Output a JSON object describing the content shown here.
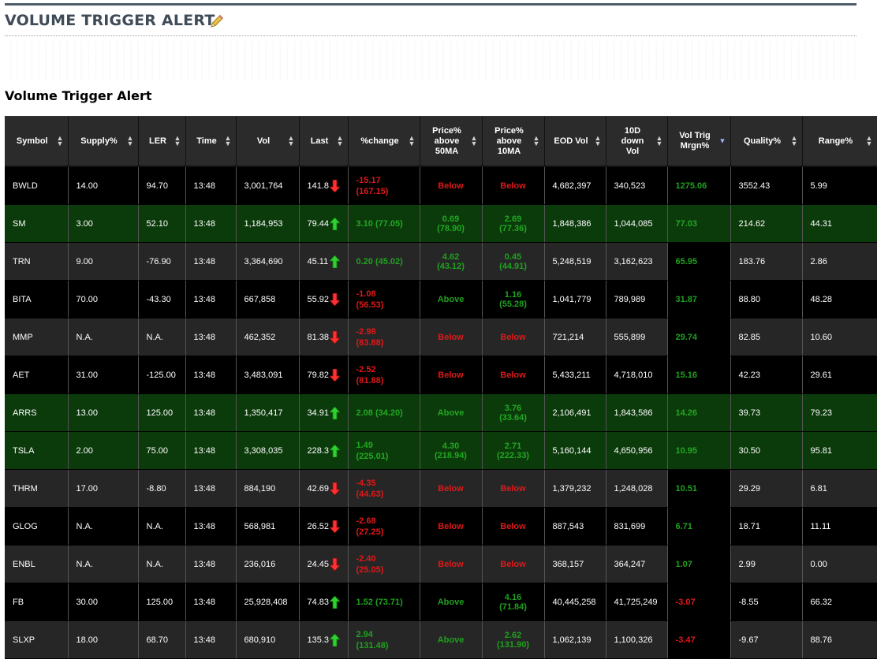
{
  "header": {
    "title": "VOLUME TRIGGER ALERT",
    "edit_icon": "pencil-icon"
  },
  "section": {
    "title": "Volume Trigger Alert"
  },
  "colors": {
    "negative": "#e01818",
    "positive": "#1fa11f",
    "row_green": "#0b3a0b",
    "header_bg": "#2b2b2b"
  },
  "table": {
    "columns": [
      {
        "label": "Symbol"
      },
      {
        "label": "Supply%"
      },
      {
        "label": "LER"
      },
      {
        "label": "Time"
      },
      {
        "label": "Vol"
      },
      {
        "label": "Last"
      },
      {
        "label": "%change"
      },
      {
        "label": "Price% above 50MA"
      },
      {
        "label": "Price% above 10MA"
      },
      {
        "label": "EOD Vol"
      },
      {
        "label": "10D down Vol"
      },
      {
        "label": "Vol Trig Mrgn%"
      },
      {
        "label": "Quality%"
      },
      {
        "label": "Range%"
      }
    ],
    "sorted_column": "Vol Trig Mrgn%",
    "rows": [
      {
        "symbol": "BWLD",
        "supply": "14.00",
        "ler": "94.70",
        "time": "13:48",
        "vol": "3,001,764",
        "last": "141.8",
        "dir": "down",
        "change": "-15.17\n(167.15)",
        "ch_sign": "neg",
        "ma50": "Below",
        "ma50_sign": "neg",
        "ma10": "Below",
        "ma10_sign": "neg",
        "eod": "4,682,397",
        "down10": "340,523",
        "margin": "1275.06",
        "m_sign": "pos",
        "quality": "3552.43",
        "range": "5.99",
        "bg": "dark"
      },
      {
        "symbol": "SM",
        "supply": "3.00",
        "ler": "52.10",
        "time": "13:48",
        "vol": "1,184,953",
        "last": "79.44",
        "dir": "up",
        "change": "3.10 (77.05)",
        "ch_sign": "pos",
        "ma50": "0.69\n(78.90)",
        "ma50_sign": "pos",
        "ma10": "2.69\n(77.36)",
        "ma10_sign": "pos",
        "eod": "1,848,386",
        "down10": "1,044,085",
        "margin": "77.03",
        "m_sign": "pos",
        "quality": "214.62",
        "range": "44.31",
        "bg": "green"
      },
      {
        "symbol": "TRN",
        "supply": "9.00",
        "ler": "-76.90",
        "time": "13:48",
        "vol": "3,364,690",
        "last": "45.11",
        "dir": "up",
        "change": "0.20 (45.02)",
        "ch_sign": "pos",
        "ma50": "4.62\n(43.12)",
        "ma50_sign": "pos",
        "ma10": "0.45\n(44.91)",
        "ma10_sign": "pos",
        "eod": "5,248,519",
        "down10": "3,162,623",
        "margin": "65.95",
        "m_sign": "pos",
        "quality": "183.76",
        "range": "2.86",
        "bg": "gray"
      },
      {
        "symbol": "BITA",
        "supply": "70.00",
        "ler": "-43.30",
        "time": "13:48",
        "vol": "667,858",
        "last": "55.92",
        "dir": "down",
        "change": "-1.08\n(56.53)",
        "ch_sign": "neg",
        "ma50": "Above",
        "ma50_sign": "pos",
        "ma10": "1.16\n(55.28)",
        "ma10_sign": "pos",
        "eod": "1,041,779",
        "down10": "789,989",
        "margin": "31.87",
        "m_sign": "pos",
        "quality": "88.80",
        "range": "48.28",
        "bg": "dark"
      },
      {
        "symbol": "MMP",
        "supply": "N.A.",
        "ler": "N.A.",
        "time": "13:48",
        "vol": "462,352",
        "last": "81.38",
        "dir": "down",
        "change": "-2.98\n(83.88)",
        "ch_sign": "neg",
        "ma50": "Below",
        "ma50_sign": "neg",
        "ma10": "Below",
        "ma10_sign": "neg",
        "eod": "721,214",
        "down10": "555,899",
        "margin": "29.74",
        "m_sign": "pos",
        "quality": "82.85",
        "range": "10.60",
        "bg": "gray"
      },
      {
        "symbol": "AET",
        "supply": "31.00",
        "ler": "-125.00",
        "time": "13:48",
        "vol": "3,483,091",
        "last": "79.82",
        "dir": "down",
        "change": "-2.52\n(81.88)",
        "ch_sign": "neg",
        "ma50": "Below",
        "ma50_sign": "neg",
        "ma10": "Below",
        "ma10_sign": "neg",
        "eod": "5,433,211",
        "down10": "4,718,010",
        "margin": "15.16",
        "m_sign": "pos",
        "quality": "42.23",
        "range": "29.61",
        "bg": "dark"
      },
      {
        "symbol": "ARRS",
        "supply": "13.00",
        "ler": "125.00",
        "time": "13:48",
        "vol": "1,350,417",
        "last": "34.91",
        "dir": "up",
        "change": "2.08 (34.20)",
        "ch_sign": "pos",
        "ma50": "Above",
        "ma50_sign": "pos",
        "ma10": "3.76\n(33.64)",
        "ma10_sign": "pos",
        "eod": "2,106,491",
        "down10": "1,843,586",
        "margin": "14.26",
        "m_sign": "pos",
        "quality": "39.73",
        "range": "79.23",
        "bg": "green"
      },
      {
        "symbol": "TSLA",
        "supply": "2.00",
        "ler": "75.00",
        "time": "13:48",
        "vol": "3,308,035",
        "last": "228.3",
        "dir": "up",
        "change": "1.49\n(225.01)",
        "ch_sign": "pos",
        "ma50": "4.30\n(218.94)",
        "ma50_sign": "pos",
        "ma10": "2.71\n(222.33)",
        "ma10_sign": "pos",
        "eod": "5,160,144",
        "down10": "4,650,956",
        "margin": "10.95",
        "m_sign": "pos",
        "quality": "30.50",
        "range": "95.81",
        "bg": "green"
      },
      {
        "symbol": "THRM",
        "supply": "17.00",
        "ler": "-8.80",
        "time": "13:48",
        "vol": "884,190",
        "last": "42.69",
        "dir": "down",
        "change": "-4.35\n(44.63)",
        "ch_sign": "neg",
        "ma50": "Below",
        "ma50_sign": "neg",
        "ma10": "Below",
        "ma10_sign": "neg",
        "eod": "1,379,232",
        "down10": "1,248,028",
        "margin": "10.51",
        "m_sign": "pos",
        "quality": "29.29",
        "range": "6.81",
        "bg": "gray"
      },
      {
        "symbol": "GLOG",
        "supply": "N.A.",
        "ler": "N.A.",
        "time": "13:48",
        "vol": "568,981",
        "last": "26.52",
        "dir": "down",
        "change": "-2.68\n(27.25)",
        "ch_sign": "neg",
        "ma50": "Below",
        "ma50_sign": "neg",
        "ma10": "Below",
        "ma10_sign": "neg",
        "eod": "887,543",
        "down10": "831,699",
        "margin": "6.71",
        "m_sign": "pos",
        "quality": "18.71",
        "range": "11.11",
        "bg": "dark"
      },
      {
        "symbol": "ENBL",
        "supply": "N.A.",
        "ler": "N.A.",
        "time": "13:48",
        "vol": "236,016",
        "last": "24.45",
        "dir": "down",
        "change": "-2.40\n(25.05)",
        "ch_sign": "neg",
        "ma50": "Below",
        "ma50_sign": "neg",
        "ma10": "Below",
        "ma10_sign": "neg",
        "eod": "368,157",
        "down10": "364,247",
        "margin": "1.07",
        "m_sign": "pos",
        "quality": "2.99",
        "range": "0.00",
        "bg": "gray"
      },
      {
        "symbol": "FB",
        "supply": "30.00",
        "ler": "125.00",
        "time": "13:48",
        "vol": "25,928,408",
        "last": "74.83",
        "dir": "up",
        "change": "1.52 (73.71)",
        "ch_sign": "pos",
        "ma50": "Above",
        "ma50_sign": "pos",
        "ma10": "4.16\n(71.84)",
        "ma10_sign": "pos",
        "eod": "40,445,258",
        "down10": "41,725,249",
        "margin": "-3.07",
        "m_sign": "neg",
        "quality": "-8.55",
        "range": "66.32",
        "bg": "dark"
      },
      {
        "symbol": "SLXP",
        "supply": "18.00",
        "ler": "68.70",
        "time": "13:48",
        "vol": "680,910",
        "last": "135.3",
        "dir": "up",
        "change": "2.94\n(131.48)",
        "ch_sign": "pos",
        "ma50": "Above",
        "ma50_sign": "pos",
        "ma10": "2.62\n(131.90)",
        "ma10_sign": "pos",
        "eod": "1,062,139",
        "down10": "1,100,326",
        "margin": "-3.47",
        "m_sign": "neg",
        "quality": "-9.67",
        "range": "88.76",
        "bg": "gray"
      }
    ]
  }
}
